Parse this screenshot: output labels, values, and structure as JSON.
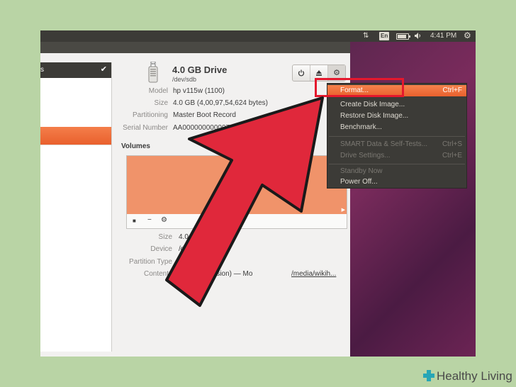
{
  "topbar": {
    "lang": "En",
    "time": "4:41 PM",
    "battery_level": 0.85,
    "icons": [
      "network-transfer-icon",
      "keyboard-language-icon",
      "battery-icon",
      "volume-icon",
      "system-gear-icon"
    ]
  },
  "left_panel": {
    "header_text": "s",
    "selected_item_color": "#f0763f"
  },
  "drive": {
    "name": "4.0 GB Drive",
    "path": "/dev/sdb",
    "properties": [
      {
        "label": "Model",
        "value": "hp v115w (1100)"
      },
      {
        "label": "Size",
        "value": "4.0 GB (4,00,97,54,624 bytes)"
      },
      {
        "label": "Partitioning",
        "value": "Master Boot Record"
      },
      {
        "label": "Serial Number",
        "value": "AA00000000000735"
      }
    ]
  },
  "toolbar": {
    "buttons": [
      "power-icon",
      "eject-icon",
      "gear-icon"
    ]
  },
  "volumes": {
    "title": "Volumes",
    "color": "#f0936a",
    "properties": [
      {
        "label": "Size",
        "value": "4.0 GB"
      },
      {
        "label": "Device",
        "value": "/dev"
      },
      {
        "label": "Partition Type",
        "value": ""
      },
      {
        "label": "Contents",
        "value": "rsion) — Mo",
        "link": "/media/wikih..."
      }
    ]
  },
  "menu": {
    "items": [
      {
        "label": "Format...",
        "shortcut": "Ctrl+F",
        "state": "highlighted"
      },
      {
        "label": "Create Disk Image...",
        "shortcut": "",
        "state": "normal"
      },
      {
        "label": "Restore Disk Image...",
        "shortcut": "",
        "state": "normal"
      },
      {
        "label": "Benchmark...",
        "shortcut": "",
        "state": "normal"
      },
      {
        "label": "SMART Data & Self-Tests...",
        "shortcut": "Ctrl+S",
        "state": "disabled"
      },
      {
        "label": "Drive Settings...",
        "shortcut": "Ctrl+E",
        "state": "disabled"
      },
      {
        "label": "Standby Now",
        "shortcut": "",
        "state": "disabled"
      },
      {
        "label": "Power Off...",
        "shortcut": "",
        "state": "normal"
      }
    ]
  },
  "annotation": {
    "arrow_color": "#e0283b",
    "box_color": "#e4182d"
  },
  "branding": {
    "logo_text": "Healthy Living"
  }
}
